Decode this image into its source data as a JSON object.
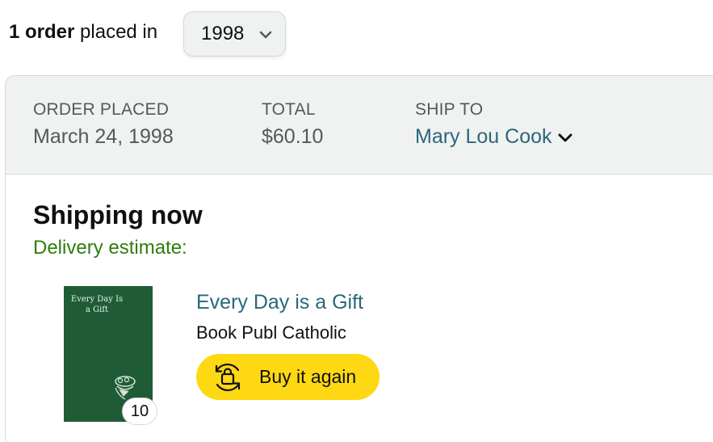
{
  "summary": {
    "count_bold": "1 order",
    "count_rest": " placed in",
    "year_selected": "1998"
  },
  "order": {
    "placed_label": "ORDER PLACED",
    "placed_value": "March 24, 1998",
    "total_label": "TOTAL",
    "total_value": "$60.10",
    "ship_label": "SHIP TO",
    "ship_value": "Mary Lou Cook"
  },
  "shipment": {
    "status": "Shipping now",
    "delivery": "Delivery estimate:"
  },
  "item": {
    "cover_title": "Every Day Is a Gift",
    "quantity": "10",
    "title": "Every Day is a Gift",
    "author": "Book Publ Catholic",
    "buy_again_label": "Buy it again"
  },
  "icons": {
    "year_dropdown": "chevron-down-icon",
    "ship_dropdown": "chevron-down-icon",
    "buy_again": "reorder-bag-icon"
  },
  "colors": {
    "link": "#2a6779",
    "delivery_green": "#2e7d0f",
    "button_yellow": "#ffd814",
    "header_bg": "#f0f2f2",
    "book_cover": "#1f5c36"
  }
}
